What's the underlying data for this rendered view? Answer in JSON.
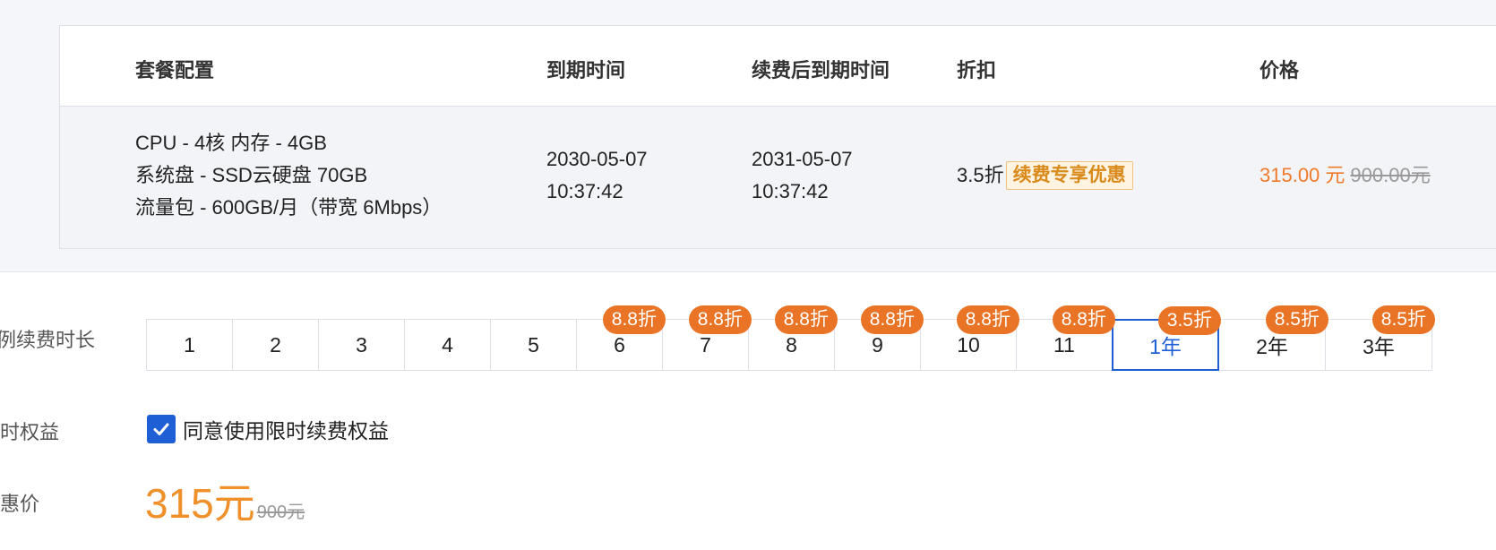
{
  "table": {
    "headers": {
      "config": "套餐配置",
      "expire": "到期时间",
      "renew_expire": "续费后到期时间",
      "discount": "折扣",
      "price": "价格"
    },
    "row": {
      "config_lines": [
        "CPU - 4核 内存 - 4GB",
        "系统盘 - SSD云硬盘 70GB",
        "流量包 - 600GB/月（带宽 6Mbps）"
      ],
      "expire_date": "2030-05-07",
      "expire_time": "10:37:42",
      "renew_date": "2031-05-07",
      "renew_time": "10:37:42",
      "discount": "3.5折",
      "promo_tag": "续费专享优惠",
      "price": "315.00 元",
      "price_original": "900.00元"
    }
  },
  "duration": {
    "label": "实例续费时长",
    "options": [
      {
        "label": "1",
        "badge": ""
      },
      {
        "label": "2",
        "badge": ""
      },
      {
        "label": "3",
        "badge": ""
      },
      {
        "label": "4",
        "badge": ""
      },
      {
        "label": "5",
        "badge": ""
      },
      {
        "label": "6",
        "badge": "8.8折"
      },
      {
        "label": "7",
        "badge": "8.8折"
      },
      {
        "label": "8",
        "badge": "8.8折"
      },
      {
        "label": "9",
        "badge": "8.8折"
      },
      {
        "label": "10",
        "badge": "8.8折"
      },
      {
        "label": "11",
        "badge": "8.8折"
      },
      {
        "label": "1年",
        "badge": "3.5折",
        "selected": true
      },
      {
        "label": "2年",
        "badge": "8.5折"
      },
      {
        "label": "3年",
        "badge": "8.5折"
      }
    ]
  },
  "benefit": {
    "label": "限时权益",
    "checkbox_label": "同意使用限时续费权益",
    "checked": true
  },
  "final_price": {
    "label": "优惠价",
    "amount": "315元",
    "original": "900元"
  },
  "colors": {
    "accent_blue": "#1f5fd6",
    "badge_orange": "#e97426",
    "price_orange": "#f0902a"
  }
}
